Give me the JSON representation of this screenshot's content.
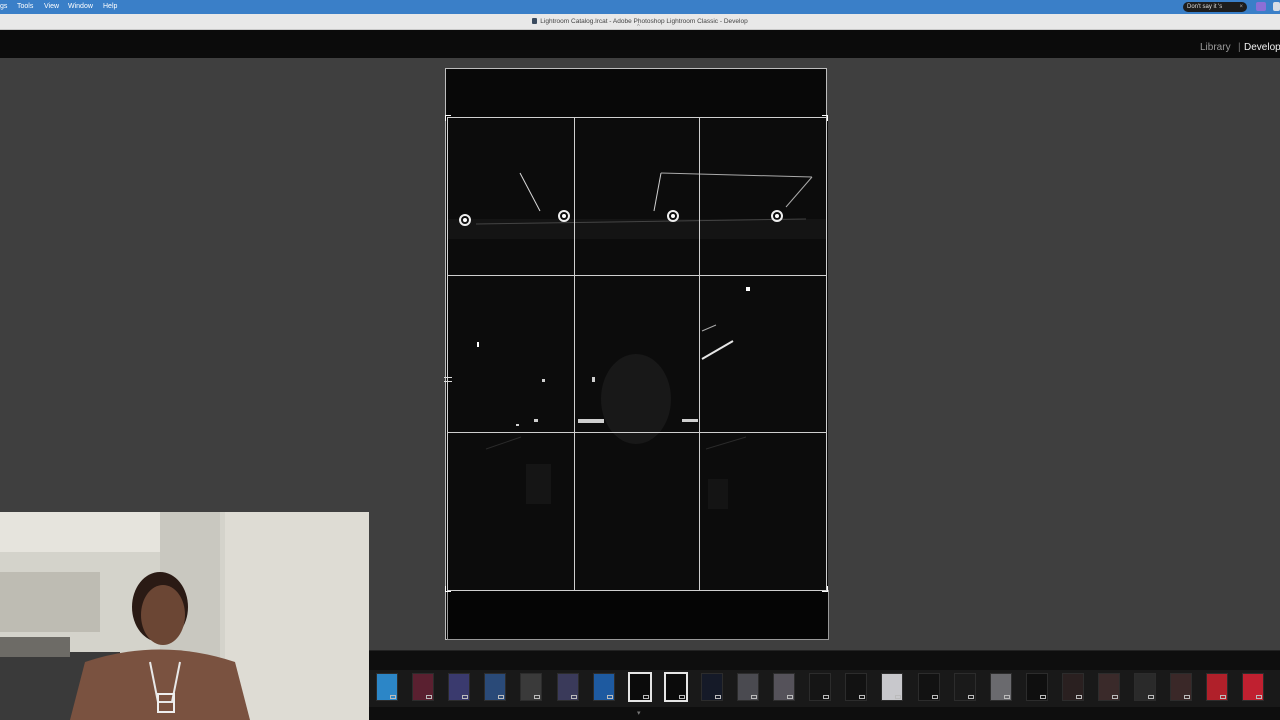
{
  "menubar": {
    "items": [
      "gs",
      "Tools",
      "View",
      "Window",
      "Help"
    ],
    "focus_pill": "Don't say it 's"
  },
  "titlebar": {
    "title": "Lightroom Catalog.lrcat - Adobe Photoshop Lightroom Classic - Develop"
  },
  "module_picker": {
    "library": "Library",
    "separator": "|",
    "develop": "Develop"
  },
  "filmstrip": {
    "thumbnail_count": 25,
    "selected_indices": [
      7,
      8
    ],
    "thumbnail_colors": [
      "#2c86c7",
      "#5a2030",
      "#3a3a6e",
      "#2a4a78",
      "#3a3a3a",
      "#3a3a5a",
      "#1e5aa0",
      "#0b0b0b",
      "#0b0b0b",
      "#151a28",
      "#4a4a50",
      "#55525a",
      "#151515",
      "#121212",
      "#c8c8cc",
      "#121212",
      "#1a1a1a",
      "#6a6a6e",
      "#0f0f0f",
      "#2a2020",
      "#3a2a2a",
      "#2a2a2a",
      "#3a2828",
      "#b0202a",
      "#c02030"
    ]
  },
  "colors": {
    "menubar": "#3a7fc8",
    "canvas": "#3f3f3f",
    "module_active": "#f2f2f2",
    "module_inactive": "#9b9b9b"
  }
}
